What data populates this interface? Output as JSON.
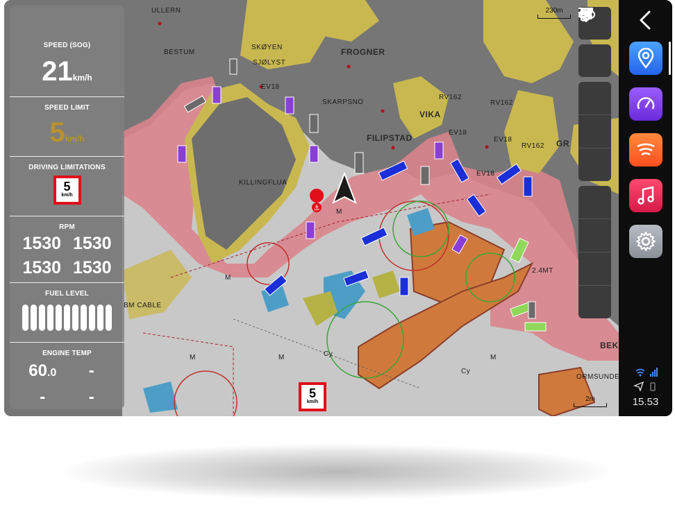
{
  "map": {
    "place_labels": [
      "ULLERN",
      "BESTUM",
      "SKØYEN",
      "SJØLYST",
      "FROGNER",
      "SKARPSNO",
      "VIKA",
      "FILIPSTAD",
      "KILLINGFLUA",
      "EV18",
      "EV18",
      "RV162",
      "RV162",
      "EV18",
      "RV162",
      "EV18",
      "GR",
      "2.4MT",
      "BM CABLE",
      "BEK",
      "ORMSUNDET",
      "M",
      "M",
      "M",
      "M",
      "M",
      "Cy",
      "Cy"
    ],
    "scale_top": "230m",
    "scale_bottom": "2m",
    "speed_sign": {
      "value": "5",
      "unit": "km/h"
    }
  },
  "panel": {
    "speed": {
      "title": "SPEED (SOG)",
      "value": "21",
      "unit": "km/h"
    },
    "speed_limit": {
      "title": "SPEED LIMIT",
      "value": "5",
      "unit": "km/h",
      "color": "#b8922e"
    },
    "driving_limitations": {
      "title": "DRIVING LIMITATIONS",
      "sign_value": "5",
      "sign_unit": "km/h"
    },
    "rpm": {
      "title": "RPM",
      "values": [
        "1530",
        "1530",
        "1530",
        "1530"
      ]
    },
    "fuel": {
      "title": "FUEL LEVEL",
      "level_fraction": 1.0
    },
    "engine_temp": {
      "title": "ENGINE TEMP",
      "value_main": "60",
      "value_dec": ".0",
      "values": [
        "-",
        "-",
        "-"
      ]
    }
  },
  "toolbar": {
    "icons": [
      "menu-icon",
      "speedometer-icon",
      "zoom-in-icon",
      "zoom-out-icon",
      "navigation-arrow-icon",
      "binoculars-icon",
      "hand-wave-icon",
      "fuel-pump-icon",
      "add-location-icon"
    ]
  },
  "dock": {
    "apps": [
      {
        "name": "map-pin-icon",
        "color": "#2f7cf6"
      },
      {
        "name": "speedometer-icon",
        "color": "#7a3ef0"
      },
      {
        "name": "sonar-icon",
        "color": "#ff6a2a"
      },
      {
        "name": "music-note-icon",
        "color": "#e5245a"
      },
      {
        "name": "gear-icon",
        "color": "#9ea2aa"
      }
    ],
    "time": "15.53"
  },
  "colors": {
    "land": "#c9b850",
    "shallow": "#d9848c",
    "dark_water": "#767676",
    "orange_zone": "#cf7a3c",
    "panel_bg": "#808080"
  }
}
